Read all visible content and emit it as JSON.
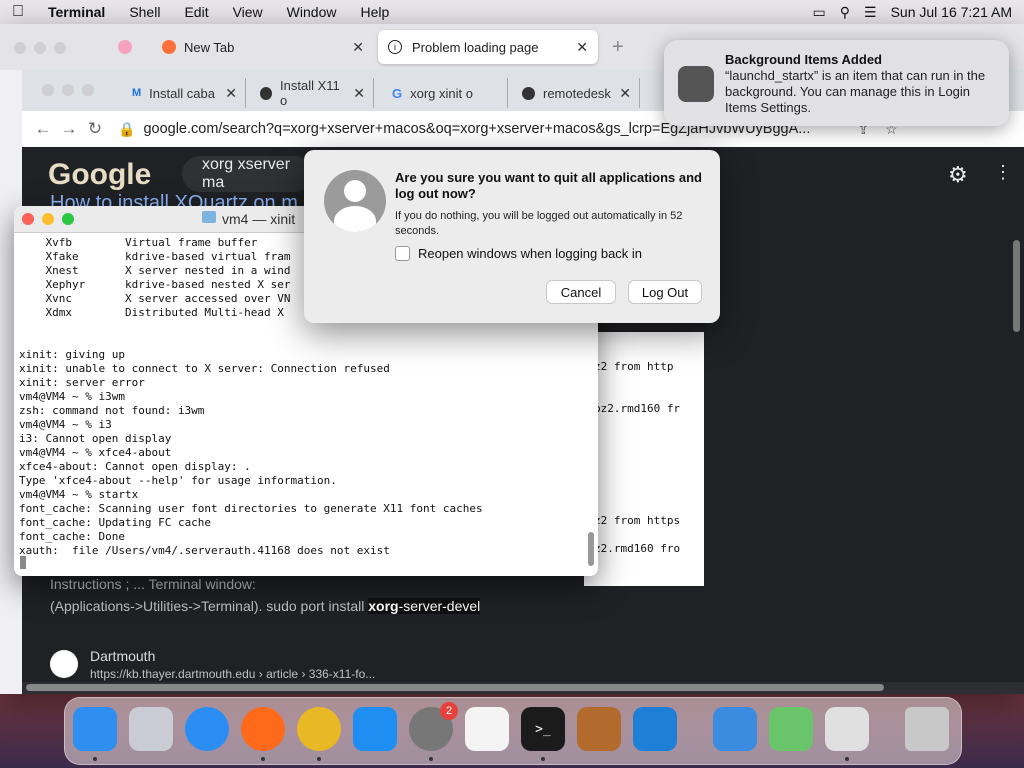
{
  "menubar": {
    "app": "Terminal",
    "items": [
      "Shell",
      "Edit",
      "View",
      "Window",
      "Help"
    ],
    "datetime": "Sun Jul 16  7:21 AM"
  },
  "firefox": {
    "tabs": [
      {
        "label": "New Tab"
      },
      {
        "label": "Problem loading page"
      }
    ]
  },
  "chrome": {
    "tabs": [
      {
        "label": "Install caba"
      },
      {
        "label": "Install X11 o"
      },
      {
        "label": "xorg xinit o"
      },
      {
        "label": "remotedesk"
      }
    ],
    "url": "google.com/search?q=xorg+xserver+macos&oq=xorg+xserver+macos&gs_lcrp=EgZjaHJvbWUyBggA...",
    "search_query": "xorg xserver ma",
    "result_title": "How to install XQuartz on m",
    "snippet_line1": "Instructions ; ... Terminal window:",
    "snippet_line2_a": "(Applications->Utilities->Terminal). sudo port install ",
    "snippet_line2_b": "xorg",
    "snippet_line2_c": "-server-devel",
    "site_name": "Dartmouth",
    "site_url": "https://kb.thayer.dartmouth.edu › article › 336-x11-fo..."
  },
  "terminal": {
    "title": "vm4 — xinit",
    "lines": [
      "    Xvfb        Virtual frame buffer",
      "    Xfake       kdrive-based virtual fram",
      "    Xnest       X server nested in a wind",
      "    Xephyr      kdrive-based nested X ser",
      "    Xvnc        X server accessed over VN",
      "    Xdmx        Distributed Multi-head X",
      "",
      "",
      "xinit: giving up",
      "xinit: unable to connect to X server: Connection refused",
      "xinit: server error",
      "vm4@VM4 ~ % i3wm",
      "zsh: command not found: i3wm",
      "vm4@VM4 ~ % i3",
      "i3: Cannot open display",
      "vm4@VM4 ~ % xfce4-about",
      "xfce4-about: Cannot open display: .",
      "Type 'xfce4-about --help' for usage information.",
      "vm4@VM4 ~ % startx",
      "font_cache: Scanning user font directories to generate X11 font caches",
      "font_cache: Updating FC cache",
      "font_cache: Done",
      "xauth:  file /Users/vm4/.serverauth.41168 does not exist"
    ],
    "back_lines": [
      "z2 from http",
      "",
      "",
      "bz2.rmd160 fr",
      "",
      "",
      "",
      "",
      "",
      "",
      "",
      "z2 from https",
      "",
      "z2.rmd160 fro"
    ]
  },
  "dialog": {
    "title": "Are you sure you want to quit all applications and log out now?",
    "subtitle": "If you do nothing, you will be logged out automatically in 52 seconds.",
    "checkbox_label": "Reopen windows when logging back in",
    "cancel": "Cancel",
    "logout": "Log Out"
  },
  "notification": {
    "title": "Background Items Added",
    "body": "“launchd_startx” is an item that can run in the background. You can manage this in Login Items Settings."
  },
  "dock": {
    "badge_count": "2",
    "apps": [
      "finder-icon",
      "launchpad-icon",
      "safari-icon",
      "firefox-icon",
      "chrome-icon",
      "app-store-icon",
      "system-settings-icon",
      "textedit-icon",
      "terminal-icon",
      "garageband-icon",
      "vscode-icon",
      "weather-icon",
      "maps-icon",
      "xquartz-icon",
      "trash-icon"
    ]
  }
}
